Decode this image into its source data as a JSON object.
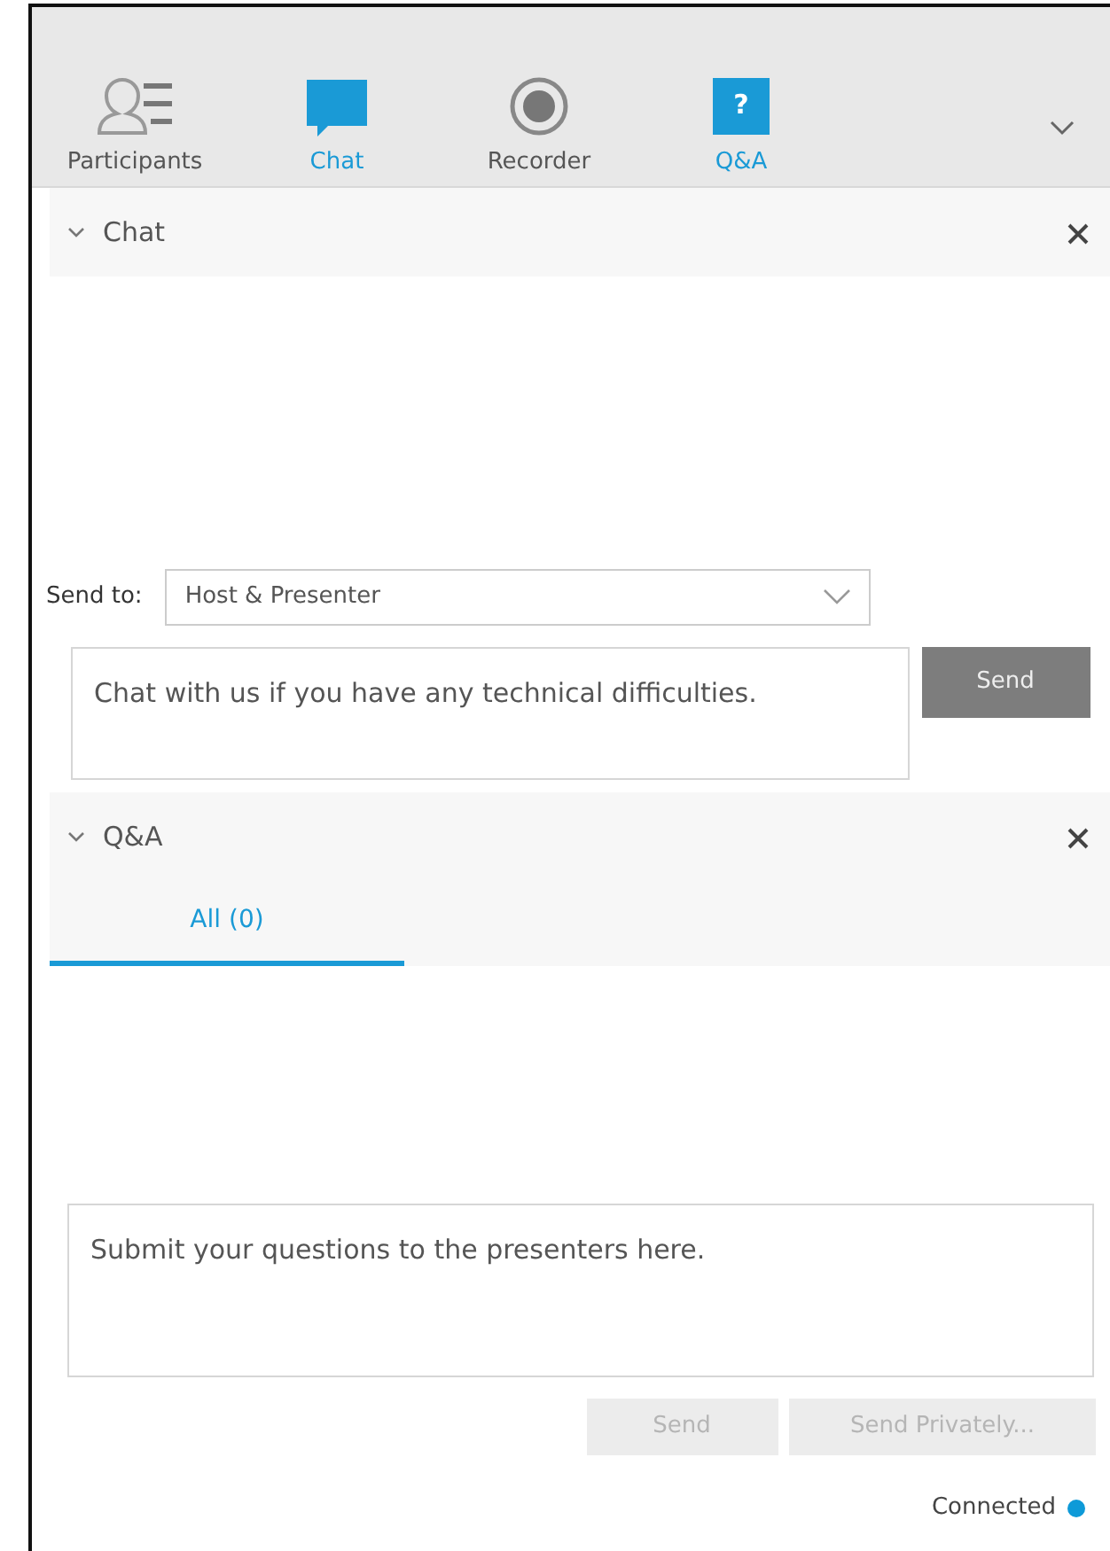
{
  "toolbar": {
    "tabs": [
      {
        "label": "Participants",
        "kind": "participants",
        "active": false
      },
      {
        "label": "Chat",
        "kind": "chat",
        "active": true
      },
      {
        "label": "Recorder",
        "kind": "recorder",
        "active": false
      },
      {
        "label": "Q&A",
        "kind": "qa",
        "glyph": "?",
        "active": true
      }
    ]
  },
  "chat": {
    "title": "Chat",
    "send_to": {
      "label": "Send to:",
      "value": "Host & Presenter"
    },
    "message": {
      "placeholder": "Chat with us if you have any technical difficulties."
    },
    "send_button": {
      "label": "Send",
      "disabled": false
    }
  },
  "qa": {
    "title": "Q&A",
    "tabs": [
      {
        "label": "All (0)",
        "selected": true
      }
    ],
    "question": {
      "placeholder": "Submit your questions to the presenters here."
    },
    "buttons": [
      {
        "label": "Send",
        "disabled": true
      },
      {
        "label": "Send Privately...",
        "disabled": true
      }
    ]
  },
  "status": {
    "label": "Connected",
    "color": "#0e9ad8"
  }
}
